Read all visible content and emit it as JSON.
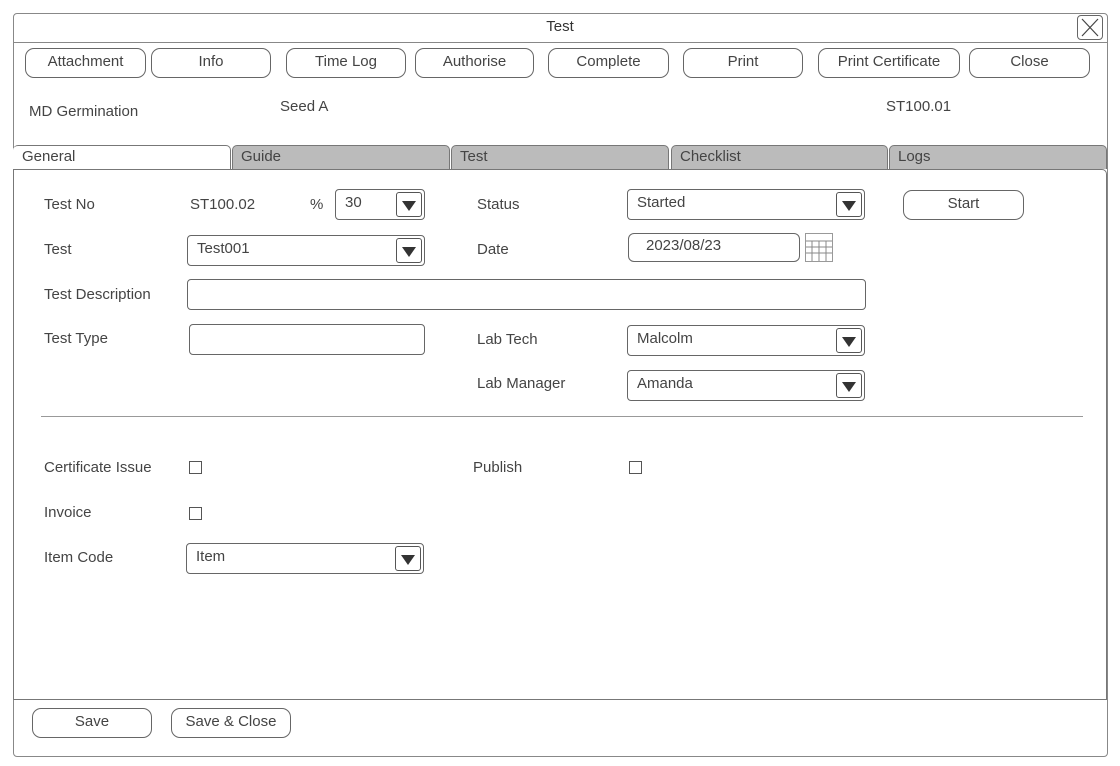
{
  "window": {
    "title": "Test"
  },
  "toolbar": [
    "Attachment",
    "Info",
    "Time Log",
    "Authorise",
    "Complete",
    "Print",
    "Print Certificate",
    "Close"
  ],
  "header": {
    "test_name": "MD Germination",
    "seed": "Seed A",
    "code": "ST100.01"
  },
  "tabs": [
    "General",
    "Guide",
    "Test",
    "Checklist",
    "Logs"
  ],
  "form": {
    "test_no_label": "Test No",
    "test_no": "ST100.02",
    "percent_label": "%",
    "percent": "30",
    "status_label": "Status",
    "status": "Started",
    "start_button": "Start",
    "test_label": "Test",
    "test": "Test001",
    "date_label": "Date",
    "date": "2023/08/23",
    "desc_label": "Test Description",
    "desc": "",
    "type_label": "Test Type",
    "type": "",
    "lab_tech_label": "Lab Tech",
    "lab_tech": "Malcolm",
    "lab_manager_label": "Lab Manager",
    "lab_manager": "Amanda",
    "cert_label": "Certificate Issue",
    "publish_label": "Publish",
    "invoice_label": "Invoice",
    "item_code_label": "Item Code",
    "item_code": "Item"
  },
  "footer": {
    "save": "Save",
    "save_close": "Save & Close"
  }
}
